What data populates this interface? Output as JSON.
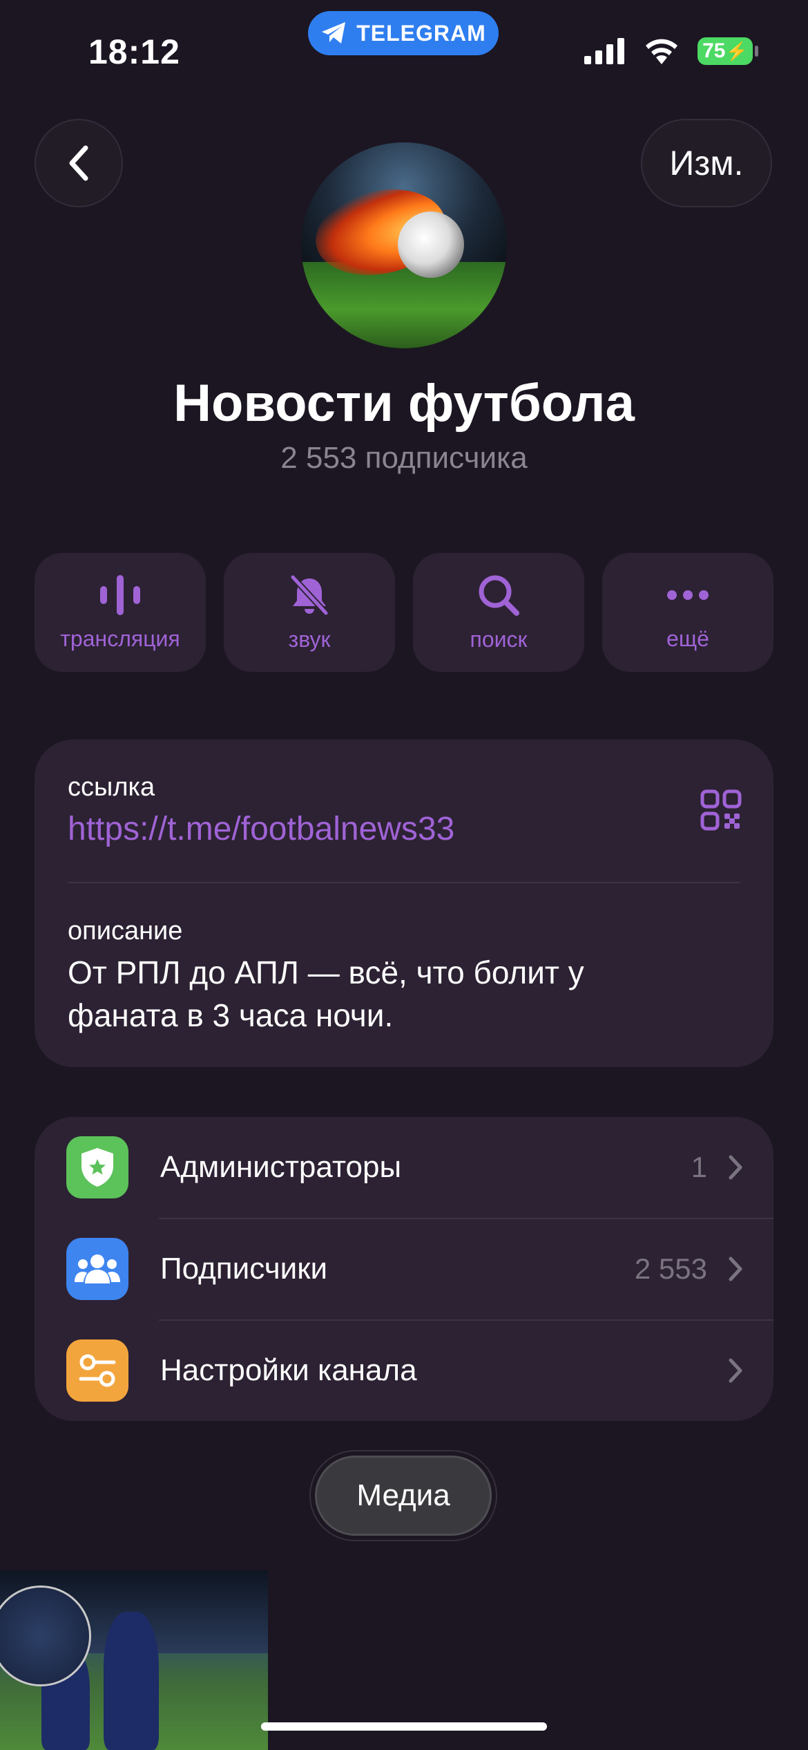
{
  "status_bar": {
    "time": "18:12",
    "app_pill": "TELEGRAM",
    "battery": "75"
  },
  "header": {
    "edit_label": "Изм."
  },
  "channel": {
    "title": "Новости футбола",
    "subscribers": "2 553 подписчика"
  },
  "actions": [
    {
      "label": "трансляция",
      "icon": "broadcast-icon"
    },
    {
      "label": "звук",
      "icon": "bell-muted-icon"
    },
    {
      "label": "поиск",
      "icon": "search-icon"
    },
    {
      "label": "ещё",
      "icon": "more-icon"
    }
  ],
  "info": {
    "link_label": "ссылка",
    "link_value": "https://t.me/footbalnews33",
    "description_label": "описание",
    "description_text": "От РПЛ до АПЛ — всё, что болит у фаната в 3 часа ночи."
  },
  "settings": [
    {
      "label": "Администраторы",
      "value": "1",
      "icon": "admin-shield-icon",
      "color": "#5cc25a"
    },
    {
      "label": "Подписчики",
      "value": "2 553",
      "icon": "subscribers-icon",
      "color": "#3e85f0"
    },
    {
      "label": "Настройки канала",
      "value": "",
      "icon": "channel-settings-icon",
      "color": "#f3a53d"
    }
  ],
  "media_tab": "Медиа",
  "colors": {
    "background": "#1c1622",
    "card": "#2c2233",
    "accent": "#a063d6",
    "telegram_blue": "#2f7ef0"
  }
}
